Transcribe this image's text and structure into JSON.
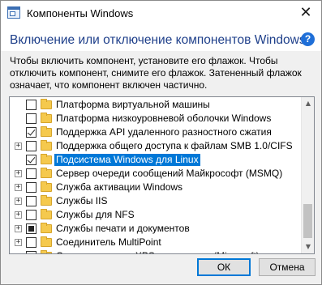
{
  "window": {
    "title": "Компоненты Windows",
    "close_glyph": "✕",
    "app_icon": "windows-features-icon"
  },
  "header": {
    "heading": "Включение или отключение компонентов Windows",
    "help_glyph": "?"
  },
  "description": "Чтобы включить компонент, установите его флажок. Чтобы отключить компонент, снимите его флажок. Затененный флажок означает, что компонент включен частично.",
  "tree": {
    "items": [
      {
        "label": "Платформа виртуальной машины",
        "state": "unchecked",
        "expandable": false
      },
      {
        "label": "Платформа низкоуровневой оболочки Windows",
        "state": "unchecked",
        "expandable": false
      },
      {
        "label": "Поддержка API удаленного разностного сжатия",
        "state": "checked",
        "expandable": false
      },
      {
        "label": "Поддержка общего доступа к файлам SMB 1.0/CIFS",
        "state": "unchecked",
        "expandable": true
      },
      {
        "label": "Подсистема Windows для Linux",
        "state": "checked",
        "expandable": false,
        "selected": true
      },
      {
        "label": "Сервер очереди сообщений Майкрософт (MSMQ)",
        "state": "unchecked",
        "expandable": true
      },
      {
        "label": "Служба активации Windows",
        "state": "unchecked",
        "expandable": true
      },
      {
        "label": "Службы IIS",
        "state": "unchecked",
        "expandable": true
      },
      {
        "label": "Службы для NFS",
        "state": "unchecked",
        "expandable": true
      },
      {
        "label": "Службы печати и документов",
        "state": "partial",
        "expandable": true
      },
      {
        "label": "Соединитель MultiPoint",
        "state": "unchecked",
        "expandable": true
      },
      {
        "label": "Средство записи XPS-документов (Microsoft)",
        "state": "checked",
        "expandable": false
      }
    ],
    "expander_glyph": "+",
    "scroll_up_glyph": "▲",
    "scroll_down_glyph": "▼"
  },
  "colors": {
    "heading": "#1e3f8a",
    "selection": "#0078d7",
    "annotation_underline": "#e0201a"
  },
  "buttons": {
    "ok": "ОК",
    "cancel": "Отмена"
  }
}
